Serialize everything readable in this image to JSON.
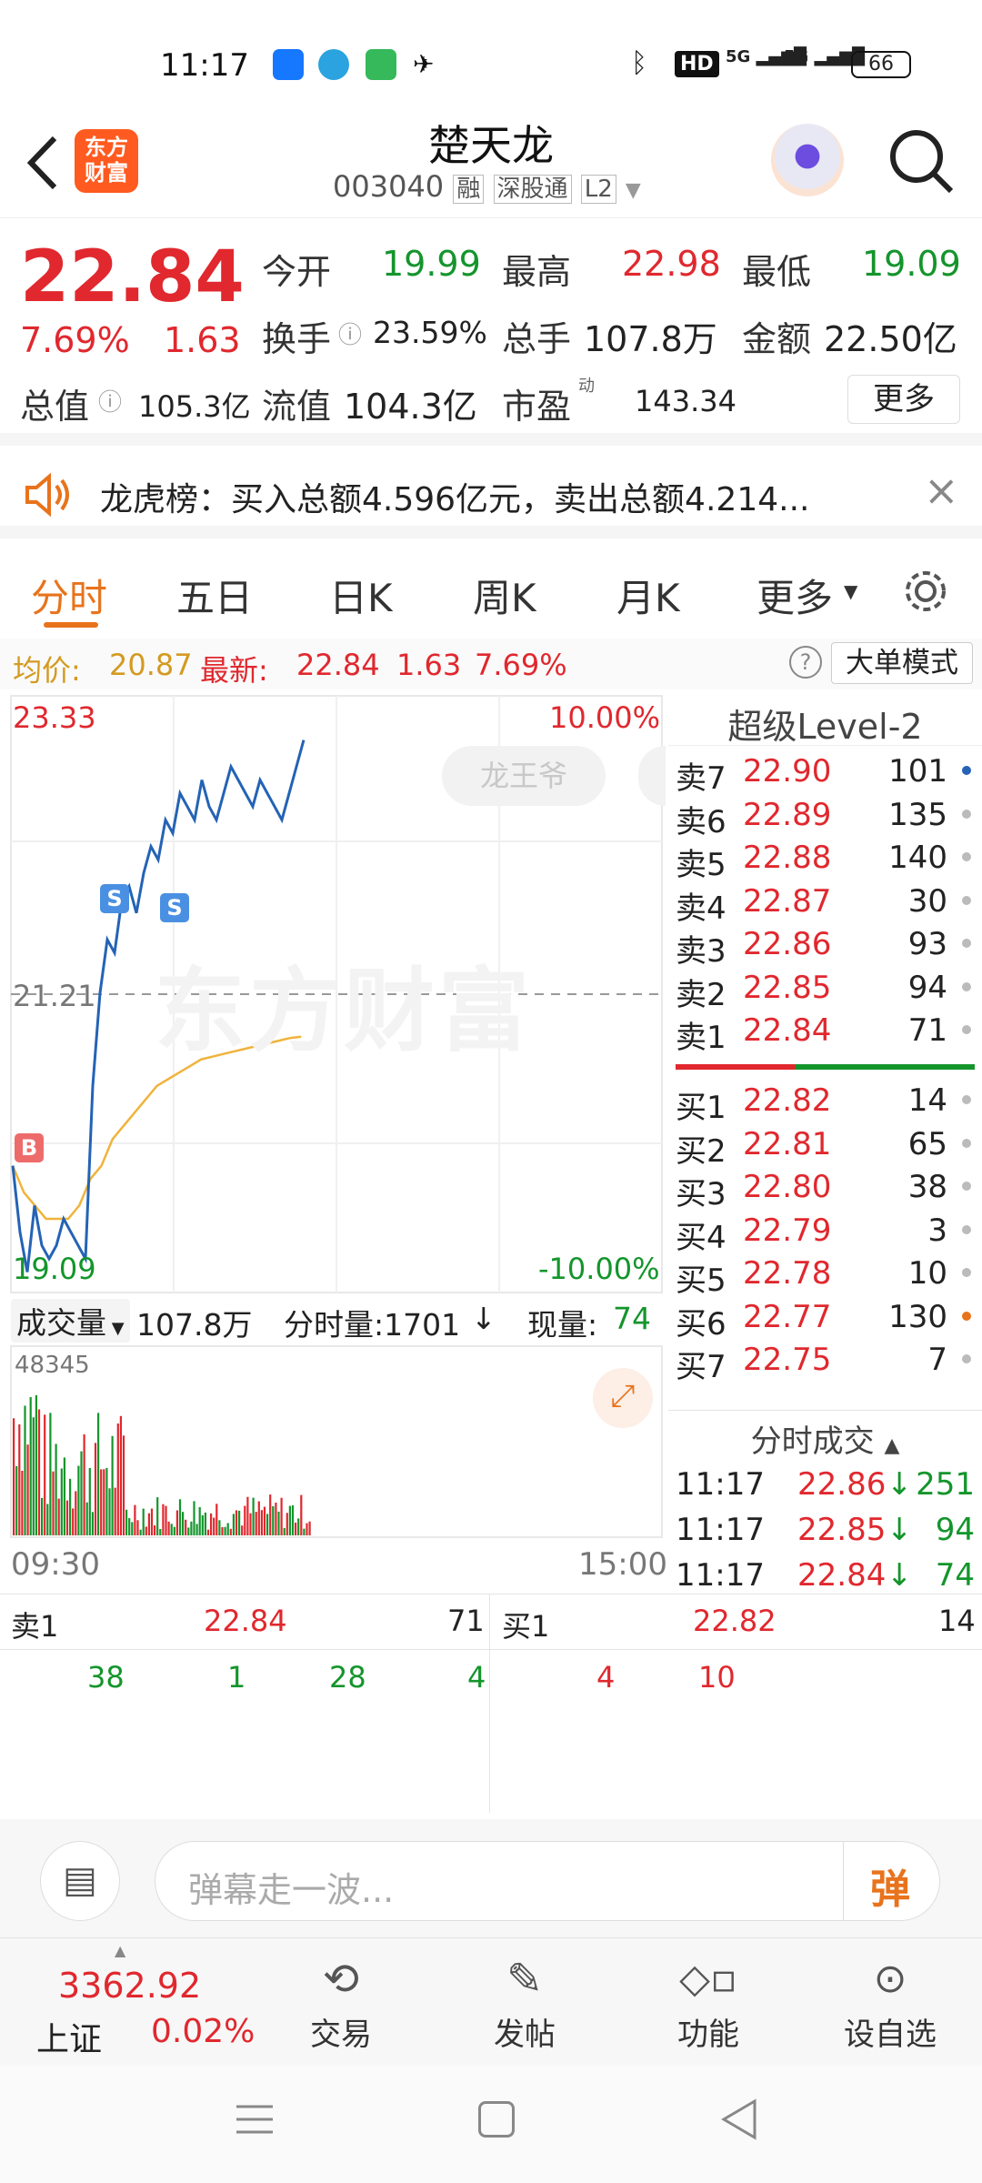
{
  "status": {
    "time": "11:17",
    "battery": "66",
    "net1": "HD",
    "net2": "5G",
    "net3": "5G"
  },
  "header": {
    "logo": "东方\n财富",
    "stock_name": "楚天龙",
    "code": "003040",
    "tags": [
      "融",
      "深股通",
      "L2"
    ]
  },
  "quote": {
    "price": "22.84",
    "pct": "7.69%",
    "chg": "1.63",
    "today_open_label": "今开",
    "today_open": "19.99",
    "high_label": "最高",
    "high": "22.98",
    "low_label": "最低",
    "low": "19.09",
    "turnover_label": "换手",
    "turnover": "23.59%",
    "volume_label": "总手",
    "volume": "107.8万",
    "amount_label": "金额",
    "amount": "22.50亿",
    "mktcap_label": "总值",
    "mktcap": "105.3亿",
    "float_label": "流值",
    "float": "104.3亿",
    "pe_label": "市盈",
    "pe_sup": "动",
    "pe": "143.34",
    "more": "更多"
  },
  "banner": {
    "text": "龙虎榜：买入总额4.596亿元，卖出总额4.214..."
  },
  "tabs": [
    "分时",
    "五日",
    "日K",
    "周K",
    "月K",
    "更多"
  ],
  "info": {
    "avg_label": "均价:",
    "avg": "20.87",
    "latest_label": "最新:",
    "latest": "22.84",
    "chg": "1.63",
    "pct": "7.69%",
    "mode": "大单模式"
  },
  "chart": {
    "top_price": "23.33",
    "top_pct": "10.00%",
    "mid_price": "21.21",
    "bottom_price": "19.09",
    "bottom_pct": "-10.00%",
    "watermark": "东方财富",
    "badge": "龙王爷",
    "vol_label": "成交量",
    "vol_total": "107.8万",
    "tick_label": "分时量:1701",
    "tick_arrow": "↓",
    "now_label": "现量:",
    "now": "74",
    "vol_max": "48345",
    "start": "09:30",
    "end": "15:00"
  },
  "chart_data": {
    "type": "line",
    "ylim": [
      19.09,
      23.33
    ],
    "price": [
      19.9,
      19.4,
      19.1,
      19.6,
      19.3,
      19.2,
      19.3,
      19.5,
      19.4,
      19.3,
      19.2,
      20.5,
      21.2,
      21.6,
      21.5,
      21.9,
      22.0,
      21.8,
      22.1,
      22.3,
      22.2,
      22.5,
      22.4,
      22.7,
      22.6,
      22.5,
      22.8,
      22.6,
      22.5,
      22.7,
      22.9,
      22.8,
      22.7,
      22.6,
      22.8,
      22.7,
      22.6,
      22.5,
      22.7,
      22.9,
      23.1
    ],
    "avg": [
      19.9,
      19.7,
      19.6,
      19.5,
      19.5,
      19.5,
      19.6,
      19.8,
      19.9,
      20.1,
      20.2,
      20.3,
      20.4,
      20.5,
      20.55,
      20.6,
      20.65,
      20.7,
      20.72,
      20.74,
      20.76,
      20.78,
      20.8,
      20.82,
      20.84,
      20.86,
      20.87
    ]
  },
  "markers": {
    "b": "B",
    "s": "S"
  },
  "level2": {
    "title": "超级Level-2",
    "asks": [
      {
        "l": "卖7",
        "p": "22.90",
        "v": "101"
      },
      {
        "l": "卖6",
        "p": "22.89",
        "v": "135"
      },
      {
        "l": "卖5",
        "p": "22.88",
        "v": "140"
      },
      {
        "l": "卖4",
        "p": "22.87",
        "v": "30"
      },
      {
        "l": "卖3",
        "p": "22.86",
        "v": "93"
      },
      {
        "l": "卖2",
        "p": "22.85",
        "v": "94"
      },
      {
        "l": "卖1",
        "p": "22.84",
        "v": "71"
      }
    ],
    "bids": [
      {
        "l": "买1",
        "p": "22.82",
        "v": "14"
      },
      {
        "l": "买2",
        "p": "22.81",
        "v": "65"
      },
      {
        "l": "买3",
        "p": "22.80",
        "v": "38"
      },
      {
        "l": "买4",
        "p": "22.79",
        "v": "3"
      },
      {
        "l": "买5",
        "p": "22.78",
        "v": "10"
      },
      {
        "l": "买6",
        "p": "22.77",
        "v": "130"
      },
      {
        "l": "买7",
        "p": "22.75",
        "v": "7"
      }
    ],
    "trades_title": "分时成交",
    "trades": [
      {
        "t": "11:17",
        "p": "22.86",
        "v": "251"
      },
      {
        "t": "11:17",
        "p": "22.85",
        "v": "94"
      },
      {
        "t": "11:17",
        "p": "22.84",
        "v": "74"
      }
    ]
  },
  "bottom_quote": {
    "ask_label": "卖1",
    "ask_price": "22.84",
    "ask_vol": "71",
    "bid_label": "买1",
    "bid_price": "22.82",
    "bid_vol": "14",
    "ask_queue": [
      "38",
      "1",
      "28",
      "4"
    ],
    "bid_queue": [
      "4",
      "10"
    ]
  },
  "comment": {
    "placeholder": "弹幕走一波...",
    "send": "弹"
  },
  "nav": {
    "index_val": "3362.92",
    "index_name": "上证",
    "index_pct": "0.02%",
    "items": [
      "交易",
      "发帖",
      "功能",
      "设自选"
    ]
  }
}
